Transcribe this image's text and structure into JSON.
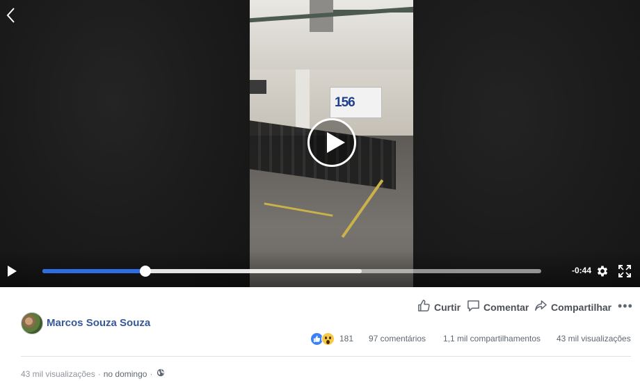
{
  "player": {
    "time_remaining": "-0:44",
    "progress_fraction": 0.206,
    "buffered_fraction": 0.64,
    "frame_text": "156",
    "icons": {
      "back": "chevron-left-icon",
      "big_play": "play-circle-icon",
      "play": "play-icon",
      "settings": "gear-icon",
      "fullscreen": "fullscreen-icon"
    }
  },
  "actions": {
    "like_label": "Curtir",
    "comment_label": "Comentar",
    "share_label": "Compartilhar",
    "more_label": "•••"
  },
  "author": {
    "name": "Marcos Souza Souza"
  },
  "stats": {
    "reaction_count": "181",
    "comments": "97 comentários",
    "shares": "1,1 mil compartilhamentos",
    "views": "43 mil visualizações"
  },
  "meta": {
    "views": "43 mil visualizações",
    "separator": "·",
    "date": "no domingo",
    "privacy_icon": "globe-icon"
  },
  "colors": {
    "accent_blue": "#2f6de6",
    "author_link": "#365899",
    "secondary_text": "#606770"
  }
}
